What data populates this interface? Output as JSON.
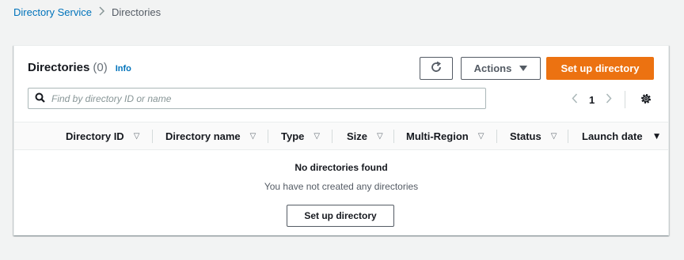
{
  "breadcrumb": {
    "parent": "Directory Service",
    "current": "Directories"
  },
  "header": {
    "title": "Directories",
    "count": "(0)",
    "info": "Info"
  },
  "toolbar": {
    "actions_label": "Actions",
    "primary_label": "Set up directory"
  },
  "search": {
    "placeholder": "Find by directory ID or name",
    "value": ""
  },
  "pagination": {
    "current_page": "1"
  },
  "table": {
    "columns": [
      {
        "label": "Directory ID",
        "sort": "▽"
      },
      {
        "label": "Directory name",
        "sort": "▽"
      },
      {
        "label": "Type",
        "sort": "▽"
      },
      {
        "label": "Size",
        "sort": "▽"
      },
      {
        "label": "Multi-Region",
        "sort": "▽"
      },
      {
        "label": "Status",
        "sort": "▽"
      },
      {
        "label": "Launch date",
        "sort": "▼"
      }
    ]
  },
  "empty_state": {
    "heading": "No directories found",
    "message": "You have not created any directories",
    "button_label": "Set up directory"
  },
  "colors": {
    "primary": "#ec7211",
    "link": "#0073bb",
    "background": "#f2f3f3"
  }
}
